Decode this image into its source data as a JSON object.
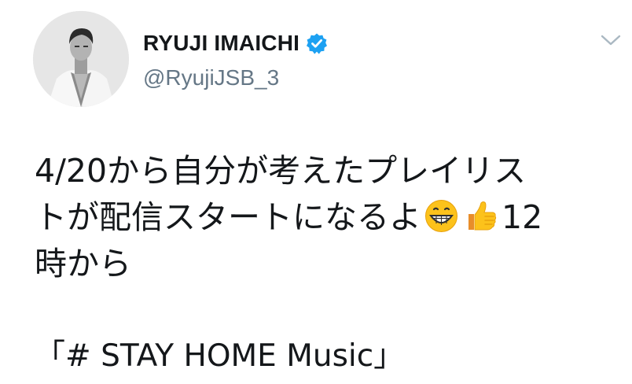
{
  "tweet": {
    "author": {
      "display_name": "RYUJI IMAICHI",
      "handle": "@RyujiJSB_3",
      "verified": true,
      "avatar_icon": "profile-photo"
    },
    "menu_icon": "chevron-down-icon",
    "text": {
      "line1": "4/20から自分が考えたプレイリス",
      "line2_text": "トが配信スタートになるよ",
      "line2_emoji1": "grinning-face-emoji",
      "line2_emoji2": "thumbs-up-emoji",
      "line2_tail": "12",
      "line3": "時から",
      "hashtag_line": "「# STAY HOME Music」"
    },
    "colors": {
      "text": "#14171a",
      "secondary": "#657786",
      "verified_badge": "#1da1f2",
      "caret": "#aab8c2"
    }
  }
}
